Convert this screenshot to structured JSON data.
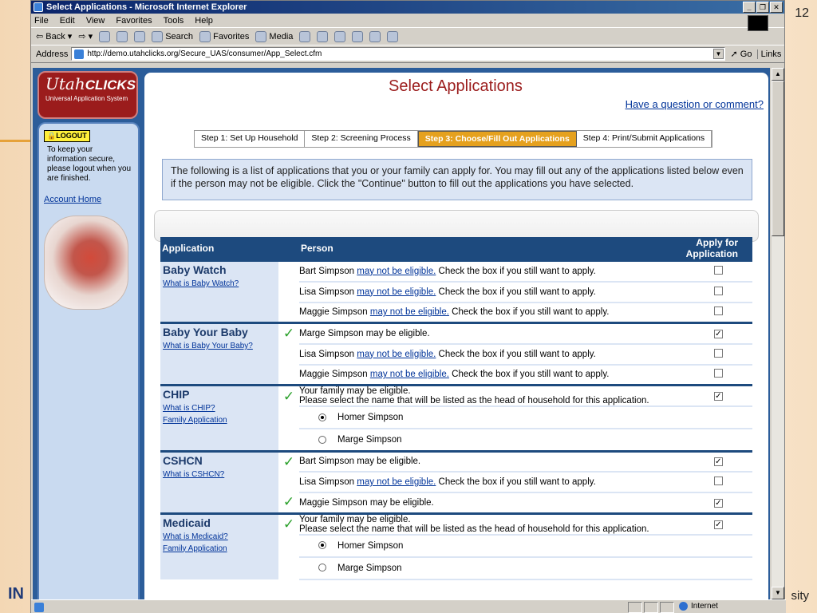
{
  "slide": {
    "number": "12",
    "left_text": "IN",
    "right_text": "sity"
  },
  "window": {
    "title": "Select Applications - Microsoft Internet Explorer"
  },
  "menu": [
    "File",
    "Edit",
    "View",
    "Favorites",
    "Tools",
    "Help"
  ],
  "toolbar": {
    "back": "Back",
    "search": "Search",
    "favorites": "Favorites",
    "media": "Media"
  },
  "address": {
    "label": "Address",
    "url": "http://demo.utahclicks.org/Secure_UAS/consumer/App_Select.cfm",
    "go": "Go",
    "links": "Links"
  },
  "status": {
    "zone": "Internet"
  },
  "logo": {
    "utah": "Utah",
    "clicks": "CLICKS",
    "subtitle": "Universal Application System"
  },
  "sidebar": {
    "logout": "LOGOUT",
    "note": "To keep your information secure, please logout when you are finished.",
    "account_home": "Account Home"
  },
  "page": {
    "title": "Select Applications",
    "question": "Have a question or comment?",
    "intro": "The following is a list of applications that you or your family can apply for. You may fill out any of the applications listed below even if the person may not be eligible. Click the \"Continue\" button to fill out the applications you have selected."
  },
  "steps": [
    "Step 1: Set Up Household",
    "Step 2: Screening Process",
    "Step 3: Choose/Fill Out Applications",
    "Step 4: Print/Submit Applications"
  ],
  "table": {
    "col_application": "Application",
    "col_person": "Person",
    "col_apply": "Apply for Application"
  },
  "text": {
    "may_not": "may not be eligible.",
    "check_box": "Check the box if you still want to apply.",
    "family_eligible": "Your family may be eligible.",
    "select_head": "Please select the name that will be listed as the head of household for this application.",
    "family_app": "Family Application"
  },
  "apps": [
    {
      "name": "Baby Watch",
      "what": "What is Baby Watch?",
      "rows": [
        {
          "person": "Bart Simpson",
          "eligible": false,
          "checked": false
        },
        {
          "person": "Lisa Simpson",
          "eligible": false,
          "checked": false
        },
        {
          "person": "Maggie Simpson",
          "eligible": false,
          "checked": false
        }
      ]
    },
    {
      "name": "Baby Your Baby",
      "what": "What is Baby Your Baby?",
      "rows": [
        {
          "person": "Marge Simpson",
          "eligible": true,
          "checked": true,
          "text": "Marge Simpson may be eligible."
        },
        {
          "person": "Lisa Simpson",
          "eligible": false,
          "checked": false
        },
        {
          "person": "Maggie Simpson",
          "eligible": false,
          "checked": false
        }
      ]
    },
    {
      "name": "CHIP",
      "what": "What is CHIP?",
      "family": true,
      "checked": true,
      "radios": [
        {
          "name": "Homer Simpson",
          "on": true
        },
        {
          "name": "Marge Simpson",
          "on": false
        }
      ]
    },
    {
      "name": "CSHCN",
      "what": "What is CSHCN?",
      "rows": [
        {
          "person": "Bart Simpson",
          "eligible": true,
          "checked": true,
          "text": "Bart Simpson may be eligible."
        },
        {
          "person": "Lisa Simpson",
          "eligible": false,
          "checked": false
        },
        {
          "person": "Maggie Simpson",
          "eligible": true,
          "checked": true,
          "text": "Maggie Simpson may be eligible."
        }
      ]
    },
    {
      "name": "Medicaid",
      "what": "What is Medicaid?",
      "family": true,
      "checked": true,
      "radios": [
        {
          "name": "Homer Simpson",
          "on": true
        },
        {
          "name": "Marge Simpson",
          "on": false
        }
      ]
    }
  ]
}
